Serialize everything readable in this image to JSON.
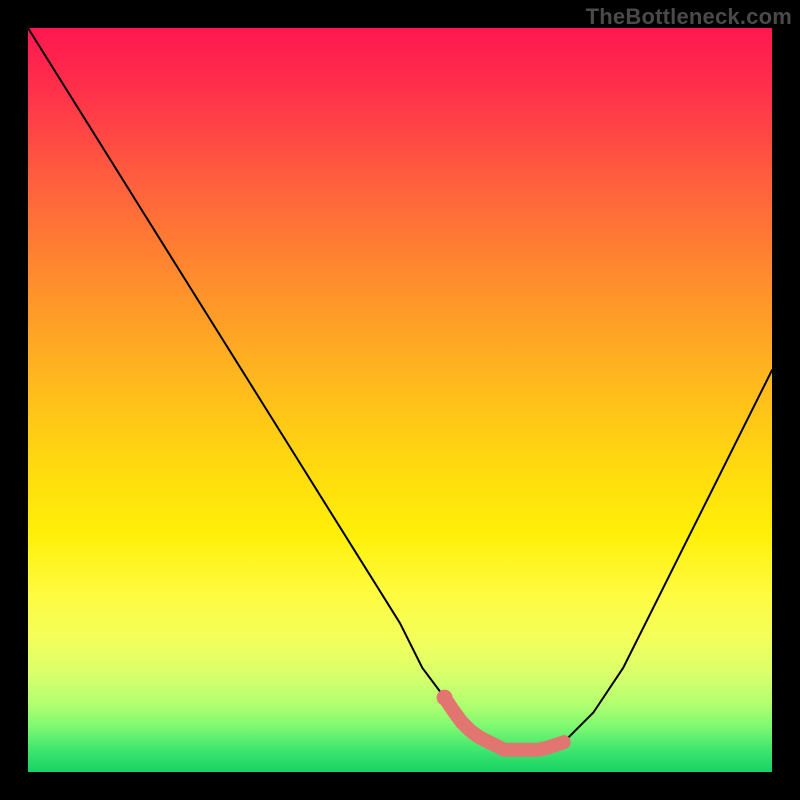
{
  "watermark": "TheBottleneck.com",
  "colors": {
    "page_bg": "#000000",
    "watermark_text": "#4a4a4a",
    "curve_stroke": "#000000",
    "highlight": "#e27570",
    "gradient_top": "#ff1750",
    "gradient_bottom": "#17d264"
  },
  "chart_data": {
    "type": "line",
    "title": "",
    "xlabel": "",
    "ylabel": "",
    "xlim": [
      0,
      100
    ],
    "ylim": [
      0,
      100
    ],
    "grid": false,
    "legend": false,
    "series": [
      {
        "name": "bottleneck-curve",
        "x": [
          0,
          5,
          10,
          15,
          20,
          25,
          30,
          35,
          40,
          45,
          50,
          53,
          56,
          58,
          60,
          62,
          64,
          67,
          69,
          72,
          76,
          80,
          84,
          88,
          92,
          96,
          100
        ],
        "values": [
          100,
          92,
          84,
          76,
          68,
          60,
          52,
          44,
          36,
          28,
          20,
          14,
          10,
          7,
          5,
          4,
          3,
          3,
          3,
          4,
          8,
          14,
          22,
          30,
          38,
          46,
          54
        ]
      }
    ],
    "highlight_region": {
      "name": "optimal-zone",
      "x_start": 56,
      "x_end": 72,
      "dot_x": 56,
      "dot_value": 10
    },
    "background_gradient_stops": [
      {
        "pos": 0,
        "color": "#ff1750"
      },
      {
        "pos": 20,
        "color": "#ff5d3e"
      },
      {
        "pos": 46,
        "color": "#ffb41f"
      },
      {
        "pos": 68,
        "color": "#fff008"
      },
      {
        "pos": 87,
        "color": "#d8ff6c"
      },
      {
        "pos": 100,
        "color": "#17d264"
      }
    ]
  }
}
